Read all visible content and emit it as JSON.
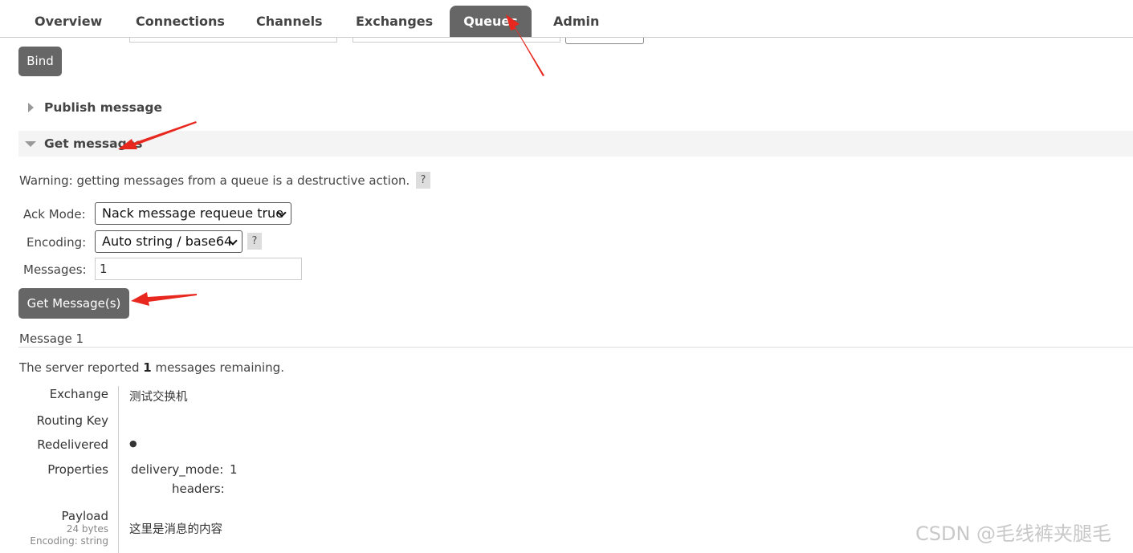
{
  "nav": {
    "tabs": [
      {
        "label": "Overview",
        "active": false
      },
      {
        "label": "Connections",
        "active": false
      },
      {
        "label": "Channels",
        "active": false
      },
      {
        "label": "Exchanges",
        "active": false
      },
      {
        "label": "Queues",
        "active": true
      },
      {
        "label": "Admin",
        "active": false
      }
    ]
  },
  "bind": {
    "button_label": "Bind"
  },
  "publish_message": {
    "title": "Publish message",
    "expanded": false
  },
  "get_messages": {
    "title": "Get messages",
    "expanded": true,
    "warning": "Warning: getting messages from a queue is a destructive action.",
    "help_symbol": "?",
    "ack_mode": {
      "label": "Ack Mode:",
      "value": "Nack message requeue true"
    },
    "encoding": {
      "label": "Encoding:",
      "value": "Auto string / base64"
    },
    "messages": {
      "label": "Messages:",
      "value": "1"
    },
    "button_label": "Get Message(s)"
  },
  "message": {
    "heading": "Message 1",
    "server_report": {
      "prefix": "The server reported ",
      "count": "1",
      "suffix": " messages remaining."
    },
    "fields": {
      "exchange": {
        "label": "Exchange",
        "value": "测试交换机"
      },
      "routing_key": {
        "label": "Routing Key",
        "value": ""
      },
      "redelivered": {
        "label": "Redelivered",
        "value": "●"
      },
      "properties": {
        "label": "Properties",
        "delivery_mode_key": "delivery_mode:",
        "delivery_mode_value": "1",
        "headers_key": "headers:"
      },
      "payload": {
        "label": "Payload",
        "size": "24 bytes",
        "encoding": "Encoding: string",
        "value": "这里是消息的内容"
      }
    }
  },
  "watermark": "CSDN @毛线裤夹腿毛",
  "colors": {
    "accent_button": "#666666",
    "annotation_arrow": "#e8281e"
  }
}
